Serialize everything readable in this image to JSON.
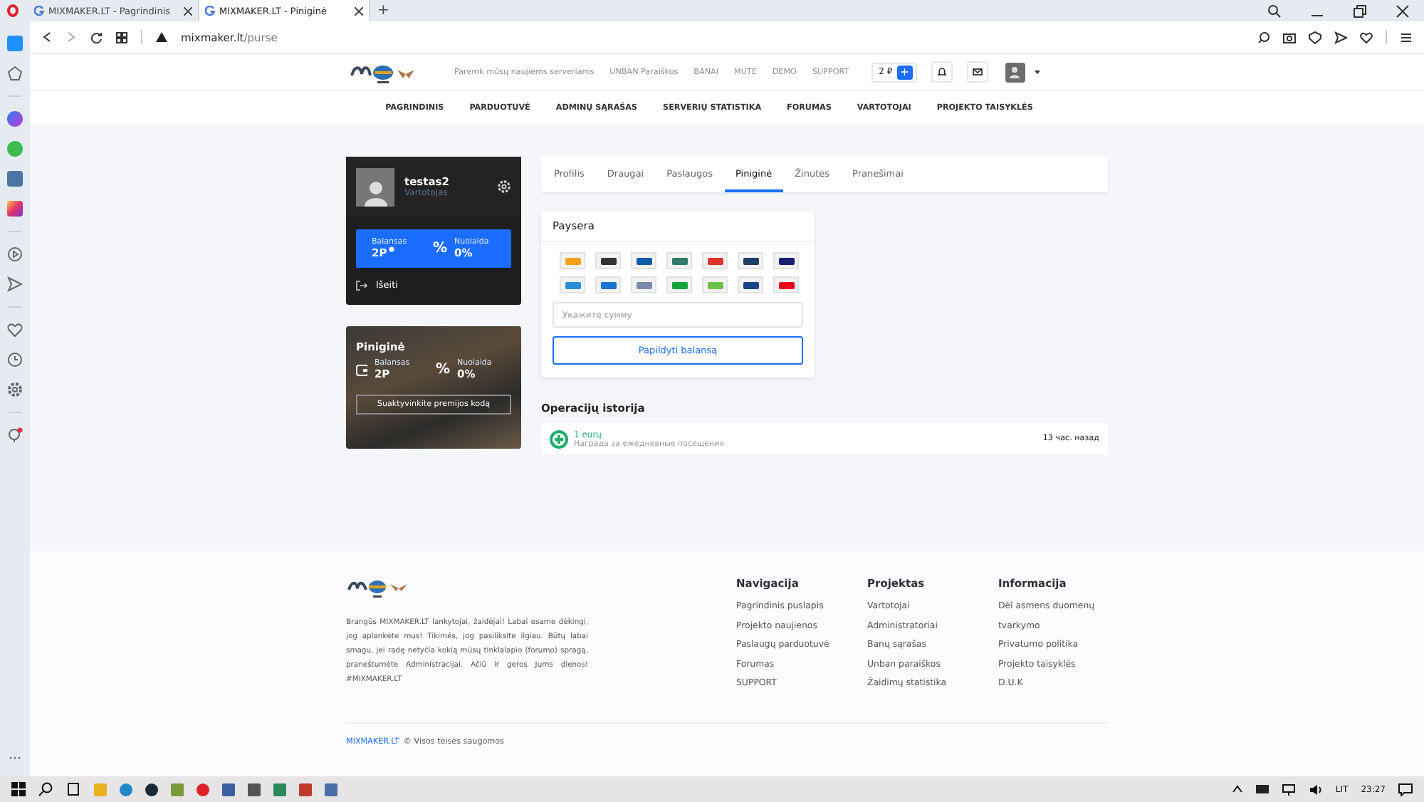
{
  "browser": {
    "tabs": [
      {
        "title": "MIXMAKER.LT - Pagrindinis",
        "selected": false
      },
      {
        "title": "MIXMAKER.LT - Piniginė",
        "selected": true
      }
    ],
    "new_tab": "+",
    "url_host": "mixmaker.lt",
    "url_path": "/purse"
  },
  "header": {
    "links": [
      "Paremk mūsų naujiems serveriams",
      "UNBAN Paraiškos",
      "BANAI",
      "MUTE",
      "DEMO",
      "SUPPORT"
    ],
    "balance": "2 ₽",
    "add": "+"
  },
  "nav": [
    "PAGRINDINIS",
    "PARDUOTUVĖ",
    "ADMINŲ SĄRAŠAS",
    "SERVERIŲ STATISTIKA",
    "FORUMAS",
    "VARTOTOJAI",
    "PROJEKTO TAISYKLĖS"
  ],
  "profile": {
    "name": "testas2",
    "role": "Vartotojas",
    "balance_label": "Balansas",
    "balance": "2P",
    "discount_label": "Nuolaida",
    "discount_sign": "%",
    "discount": "0%",
    "logout": "Išeiti"
  },
  "wallet": {
    "title": "Piniginė",
    "balance_label": "Balansas",
    "balance": "2P",
    "discount_label": "Nuolaida",
    "discount_sign": "%",
    "discount": "0%",
    "button": "Suaktyvinkite premijos kodą"
  },
  "tabs": [
    {
      "label": "Profilis",
      "selected": false
    },
    {
      "label": "Draugai",
      "selected": false
    },
    {
      "label": "Paslaugos",
      "selected": false
    },
    {
      "label": "Piniginė",
      "selected": true
    },
    {
      "label": "Žinutės",
      "selected": false
    },
    {
      "label": "Pranešimai",
      "selected": false
    }
  ],
  "paysera": {
    "title": "Paysera",
    "methods": [
      {
        "color": "#f79e1b"
      },
      {
        "color": "#333333"
      },
      {
        "color": "#0a5ca8"
      },
      {
        "color": "#2f7a6a"
      },
      {
        "color": "#e2302a"
      },
      {
        "color": "#1d3f66"
      },
      {
        "color": "#1a1f71"
      },
      {
        "color": "#2a8fd8"
      },
      {
        "color": "#1976d2"
      },
      {
        "color": "#7a8aa8"
      },
      {
        "color": "#13a538"
      },
      {
        "color": "#6cbf4a"
      },
      {
        "color": "#1c4587"
      },
      {
        "color": "#eb001b"
      }
    ],
    "placeholder": "Укажите сумму",
    "button": "Papildyti balansą"
  },
  "history": {
    "title": "Operacijų istorija",
    "items": [
      {
        "amount": "1 eurų",
        "description": "Награда за ежедневные посещения",
        "time": "13 час. назад"
      }
    ]
  },
  "footer": {
    "text": "Brangūs MIXMAKER.LT lankytojai, žaidėjai! Labai esame dėkingi, jog aplankėte mus! Tikimės, jog pasiliksite ilgiau. Būtų labai smagu, jei radę netyčia kokią mūsų tinklalapio (forumo) spragą, praneštumėte Administracijai. Ačiū ir geros Jums dienos! #MIXMAKER.LT",
    "columns": [
      {
        "title": "Navigacija",
        "links": [
          "Pagrindinis puslapis",
          "Projekto naujienos",
          "Paslaugų parduotuvė",
          "Forumas",
          "SUPPORT"
        ]
      },
      {
        "title": "Projektas",
        "links": [
          "Vartotojai",
          "Administratoriai",
          "Banų sąrašas",
          "Unban paraiškos",
          "Žaidimų statistika"
        ]
      },
      {
        "title": "Informacija",
        "links": [
          "Dėl asmens duomenų tvarkymo",
          "Privatumo politika",
          "Projekto taisyklės",
          "D.U.K"
        ]
      }
    ],
    "brand": "MIXMAKER.LT",
    "copyright": "© Visos teisės saugomos"
  },
  "taskbar": {
    "language": "LIT",
    "time": "23:27"
  }
}
